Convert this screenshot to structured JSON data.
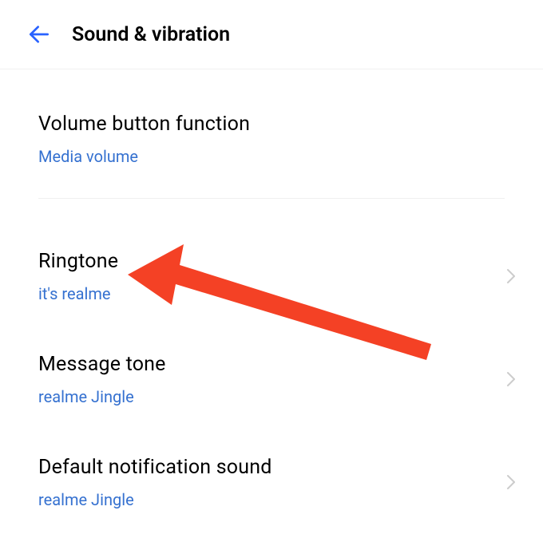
{
  "header": {
    "title": "Sound & vibration"
  },
  "volume_button": {
    "title": "Volume button function",
    "value": "Media volume"
  },
  "items": [
    {
      "title": "Ringtone",
      "value": "it's realme"
    },
    {
      "title": "Message tone",
      "value": "realme Jingle"
    },
    {
      "title": "Default notification sound",
      "value": "realme Jingle"
    }
  ]
}
